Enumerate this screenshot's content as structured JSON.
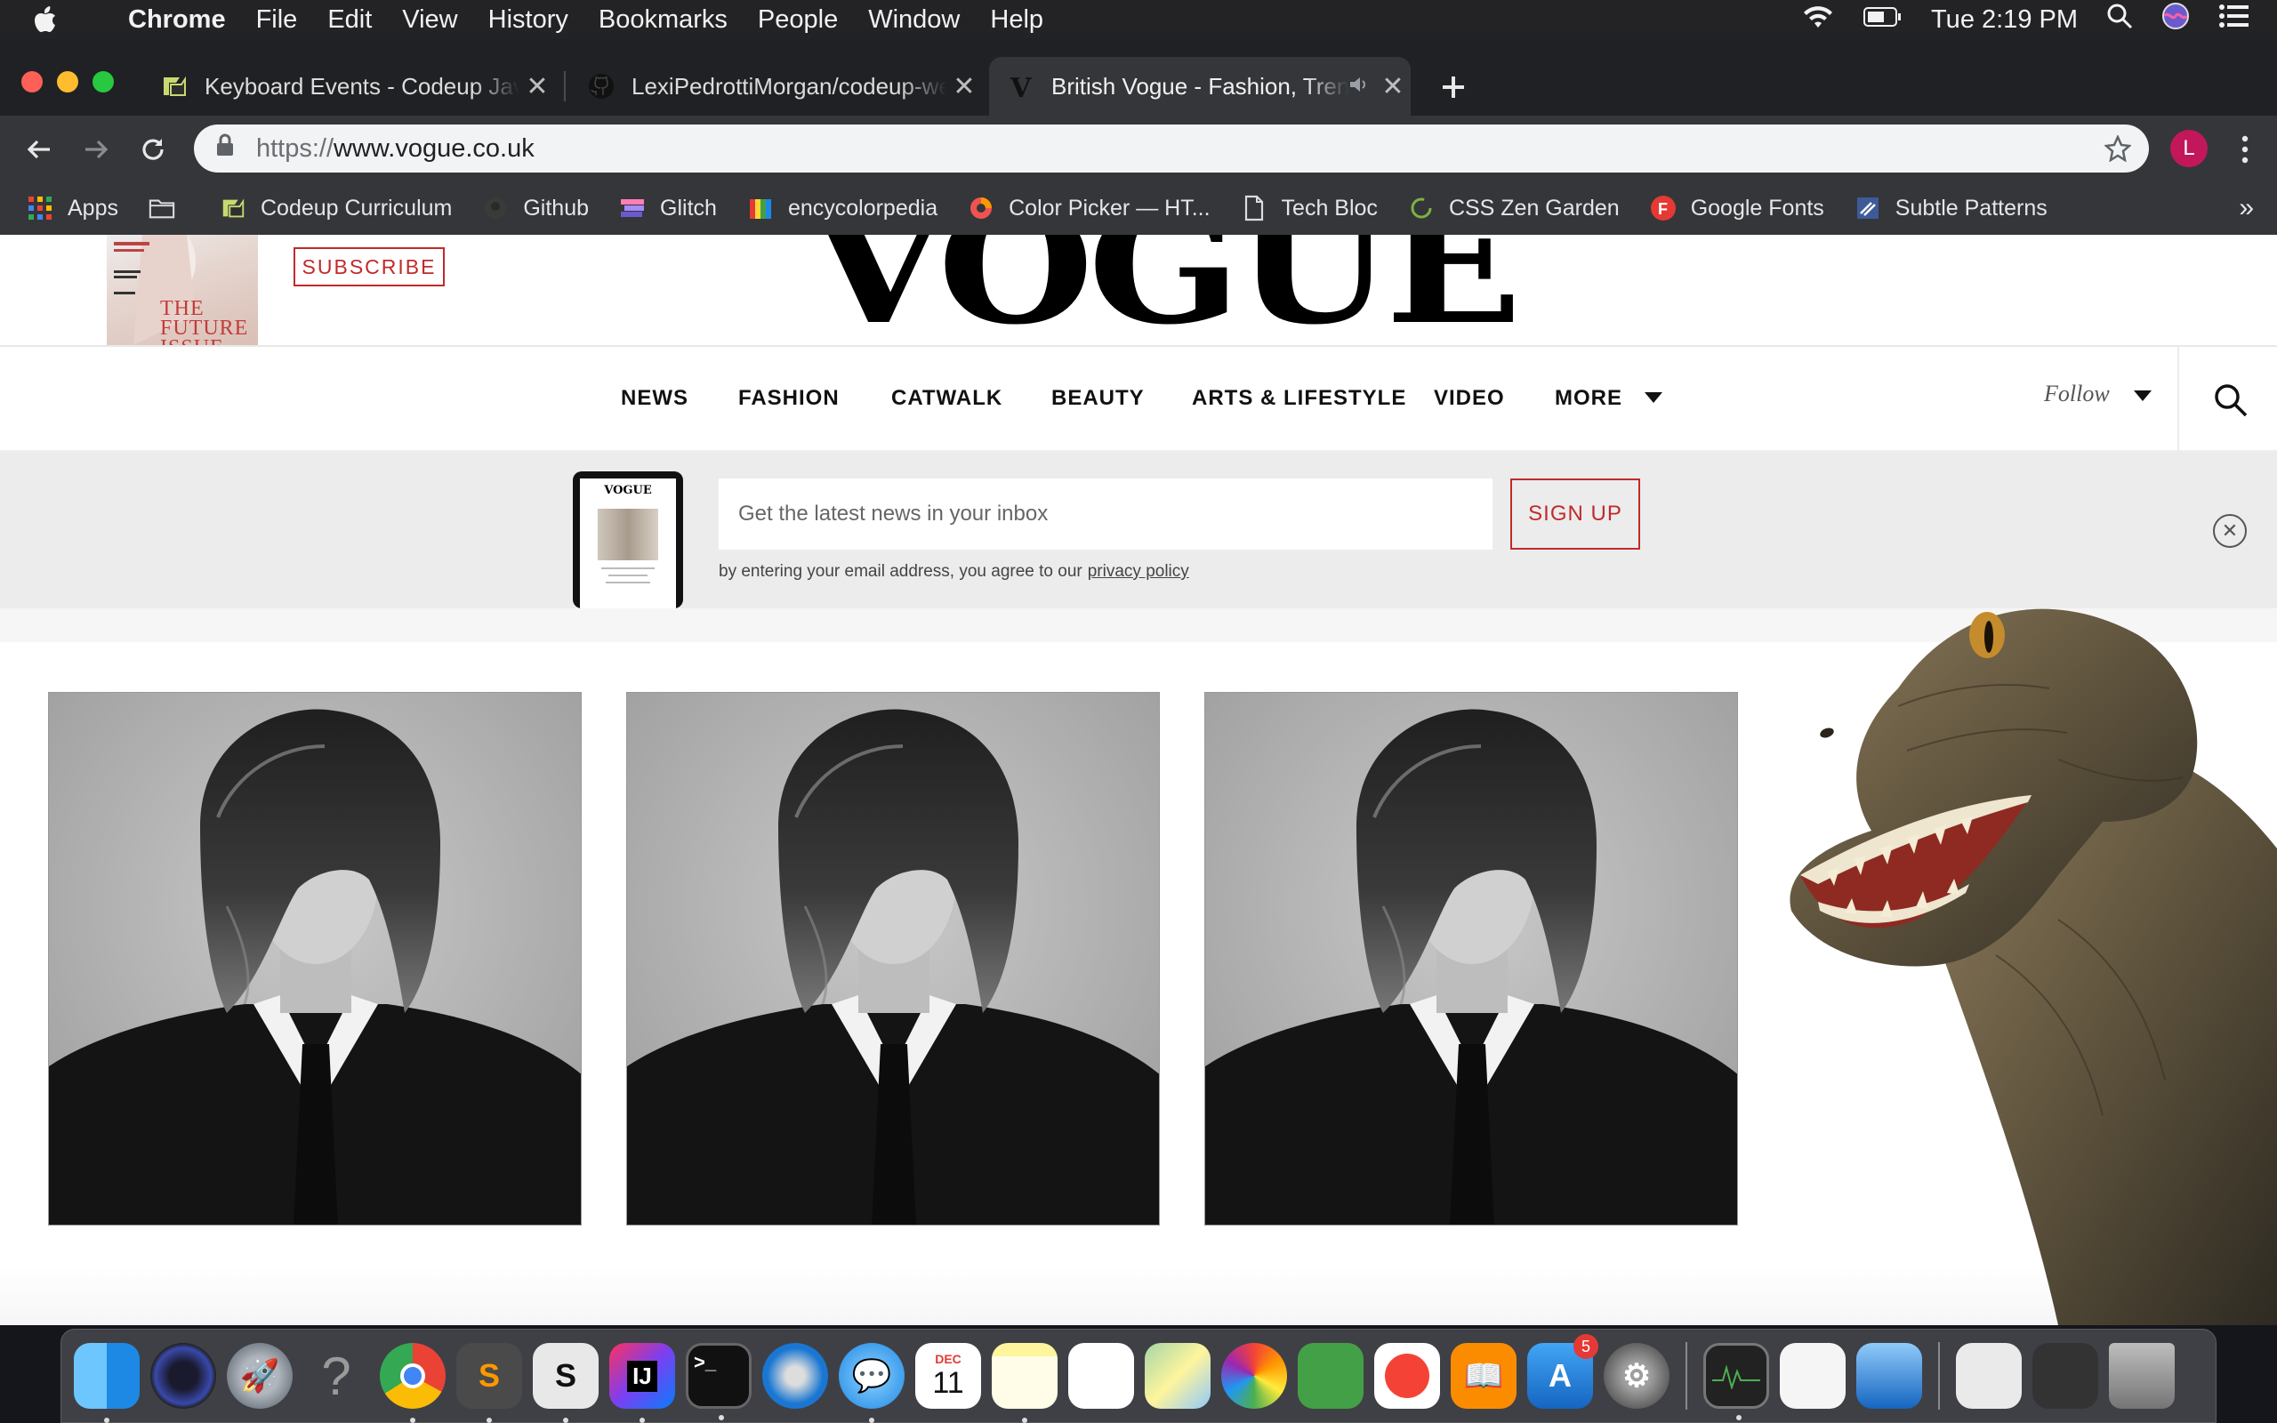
{
  "menubar": {
    "app_name": "Chrome",
    "menus": [
      "File",
      "Edit",
      "View",
      "History",
      "Bookmarks",
      "People",
      "Window",
      "Help"
    ],
    "clock": "Tue 2:19 PM",
    "status_icons": [
      "wifi-icon",
      "battery-icon",
      "spotlight-icon",
      "siri-icon",
      "notification-center-icon"
    ]
  },
  "tabs": [
    {
      "title": "Keyboard Events - Codeup JavaScript",
      "icon": "codeup-icon",
      "active": false
    },
    {
      "title": "LexiPedrottiMorgan/codeup-web-exercises",
      "icon": "github-icon",
      "active": false
    },
    {
      "title": "British Vogue - Fashion, Trends",
      "icon": "vogue-icon",
      "active": true,
      "audio": true
    }
  ],
  "toolbar": {
    "url_scheme": "https://",
    "url_host": "www.vogue.co.uk",
    "profile_initial": "L"
  },
  "bookmarks": [
    {
      "label": "Apps",
      "icon": "apps-grid-icon"
    },
    {
      "label": "",
      "icon": "folder-icon"
    },
    {
      "label": "Codeup Curriculum",
      "icon": "codeup-icon"
    },
    {
      "label": "Github",
      "icon": "github-icon"
    },
    {
      "label": "Glitch",
      "icon": "glitch-icon"
    },
    {
      "label": "encycolorpedia",
      "icon": "encycolorpedia-icon"
    },
    {
      "label": "Color Picker — HT...",
      "icon": "color-picker-icon"
    },
    {
      "label": "Tech Bloc",
      "icon": "document-icon"
    },
    {
      "label": "CSS Zen Garden",
      "icon": "zen-garden-icon"
    },
    {
      "label": "Google Fonts",
      "icon": "google-fonts-icon"
    },
    {
      "label": "Subtle Patterns",
      "icon": "subtle-patterns-icon"
    }
  ],
  "vogue": {
    "subscribe_label": "SUBSCRIBE",
    "logo_text": "VOGUE",
    "cover_text": "THE\nFUTURE\nISSUE",
    "nav": [
      "NEWS",
      "FASHION",
      "CATWALK",
      "BEAUTY",
      "ARTS & LIFESTYLE",
      "VIDEO",
      "MORE"
    ],
    "follow_label": "Follow",
    "newsletter": {
      "placeholder": "Get the latest news in your inbox",
      "signup_label": "SIGN UP",
      "legal_text": "by entering your email address, you agree to our",
      "privacy_link": "privacy policy"
    },
    "photos": [
      {
        "alt": "black and white portrait of model in suit"
      },
      {
        "alt": "black and white portrait of model in suit"
      },
      {
        "alt": "black and white portrait of model in suit"
      }
    ]
  },
  "dock": {
    "app_store_badge": "5",
    "calendar_month": "DEC",
    "calendar_day": "11",
    "items": [
      "finder-icon",
      "siri-icon",
      "launchpad-icon",
      "help-icon",
      "chrome-icon",
      "sublime-icon",
      "slack-icon",
      "intellij-icon",
      "terminal-icon",
      "safari-icon",
      "messages-icon",
      "calendar-icon",
      "notes-icon",
      "reminders-icon",
      "maps-icon",
      "photos-icon",
      "facetime-icon",
      "news-icon",
      "books-icon",
      "app-store-icon",
      "system-preferences-icon",
      "activity-monitor-icon",
      "textedit-icon",
      "preview-icon",
      "document-stack-icon",
      "screenshots-stack-icon",
      "trash-icon"
    ]
  }
}
